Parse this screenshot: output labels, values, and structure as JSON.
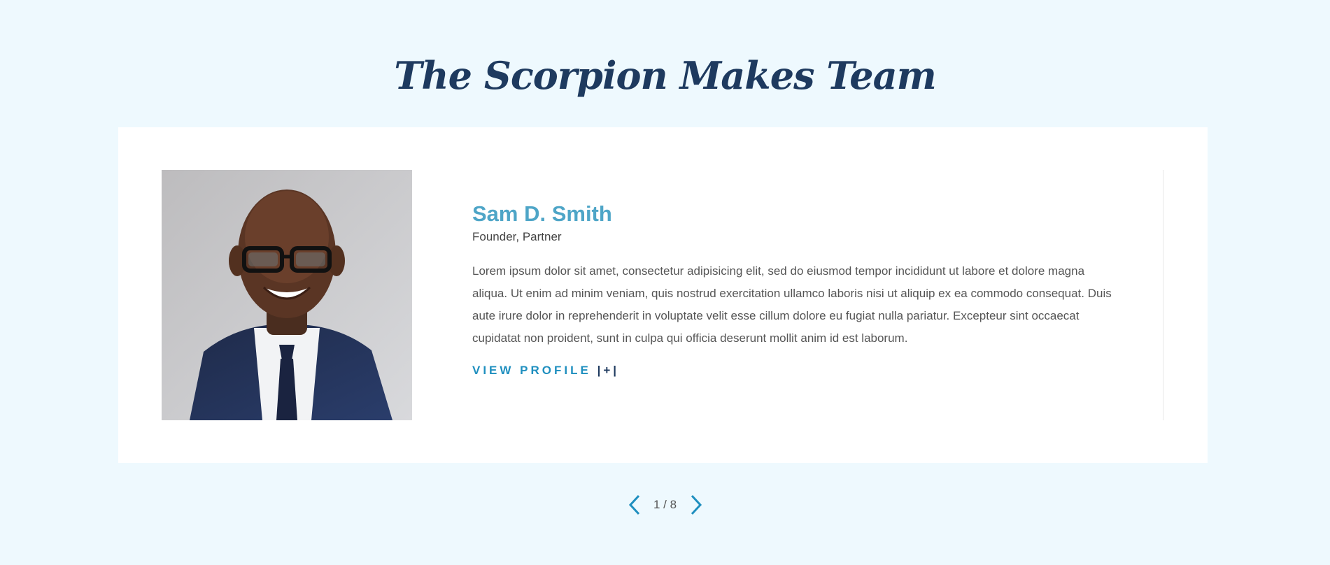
{
  "section": {
    "title": "The Scorpion Makes Team"
  },
  "member": {
    "name": "Sam D. Smith",
    "role": "Founder, Partner",
    "bio": "Lorem ipsum dolor sit amet, consectetur adipisicing elit, sed do eiusmod tempor incididunt ut labore et dolore magna aliqua. Ut enim ad minim veniam, quis nostrud exercitation ullamco laboris nisi ut aliquip ex ea commodo consequat. Duis aute irure dolor in reprehenderit in voluptate velit esse cillum dolore eu fugiat nulla pariatur. Excepteur sint occaecat cupidatat non proident, sunt in culpa qui officia deserunt mollit anim id est laborum.",
    "link_label": "VIEW PROFILE",
    "link_suffix": "|+|",
    "photo_icon": "portrait-photo"
  },
  "pager": {
    "counter": "1 / 8",
    "prev_icon": "chevron-left-icon",
    "next_icon": "chevron-right-icon"
  },
  "colors": {
    "background": "#eef9fe",
    "title": "#1e3a5f",
    "accent": "#1f8fbf",
    "name": "#4ea5c7"
  }
}
